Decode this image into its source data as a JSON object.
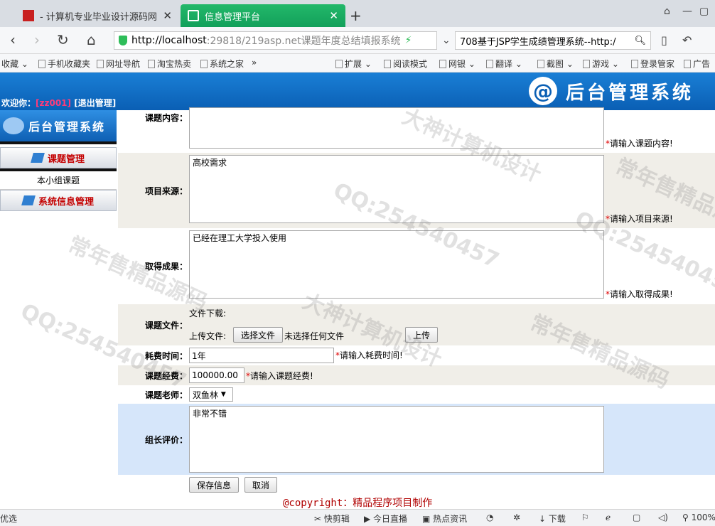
{
  "browser": {
    "tabs": [
      {
        "title": "- 计算机专业毕业设计源码网",
        "active": false
      },
      {
        "title": "信息管理平台",
        "active": true
      }
    ],
    "url_host": "http://localhost",
    "url_rest": ":29818/219asp.net课题年度总结填报系统",
    "search_text": "708基于JSP学生成绩管理系统--http:/",
    "bookmarks": [
      "收藏",
      "手机收藏夹",
      "网址导航",
      "淘宝热卖",
      "系统之家",
      "»",
      "扩展",
      "阅读模式",
      "网银",
      "翻译",
      "截图",
      "游戏",
      "登录管家",
      "广告"
    ],
    "status_items": [
      "优选",
      "快剪辑",
      "今日直播",
      "热点资讯",
      "下载",
      "100%"
    ]
  },
  "header": {
    "welcome_label": "欢迎你：",
    "username": "[zz001]",
    "logout_label": "[退出管理]",
    "brand_title": "后台管理系统",
    "brand_icon_char": "@"
  },
  "sidebar": {
    "logo_title": "后台管理系统",
    "groups": [
      {
        "label": "课题管理",
        "items": [
          "本小组课题"
        ]
      },
      {
        "label": "系统信息管理",
        "items": []
      }
    ]
  },
  "form": {
    "content": {
      "label": "课题内容：",
      "value": "",
      "hint": "请输入课题内容!"
    },
    "source": {
      "label": "项目来源：",
      "value": "高校需求",
      "hint": "请输入项目来源!"
    },
    "result": {
      "label": "取得成果：",
      "value": "已经在理工大学投入使用",
      "hint": "请输入取得成果!"
    },
    "file": {
      "label": "课题文件：",
      "download_label": "文件下载:",
      "upload_label": "上传文件:",
      "choose_button": "选择文件",
      "no_file_text": "未选择任何文件",
      "upload_button": "上传"
    },
    "time": {
      "label": "耗费时间：",
      "value": "1年",
      "hint": "请输入耗费时间!"
    },
    "budget": {
      "label": "课题经费：",
      "value": "100000.00",
      "hint": "请输入课题经费!"
    },
    "teacher": {
      "label": "课题老师：",
      "value": "双鱼林",
      "arrow": "▼"
    },
    "review": {
      "label": "组长评价：",
      "value": "非常不错"
    },
    "required_mark": "*",
    "save_button": "保存信息",
    "cancel_button": "取消"
  },
  "footer": {
    "copyright_prefix": "@copyright：",
    "copyright_text": "精品程序项目制作"
  },
  "watermarks": [
    "QQ:254540457",
    "大神计算机设计",
    "常年售精品源码"
  ]
}
